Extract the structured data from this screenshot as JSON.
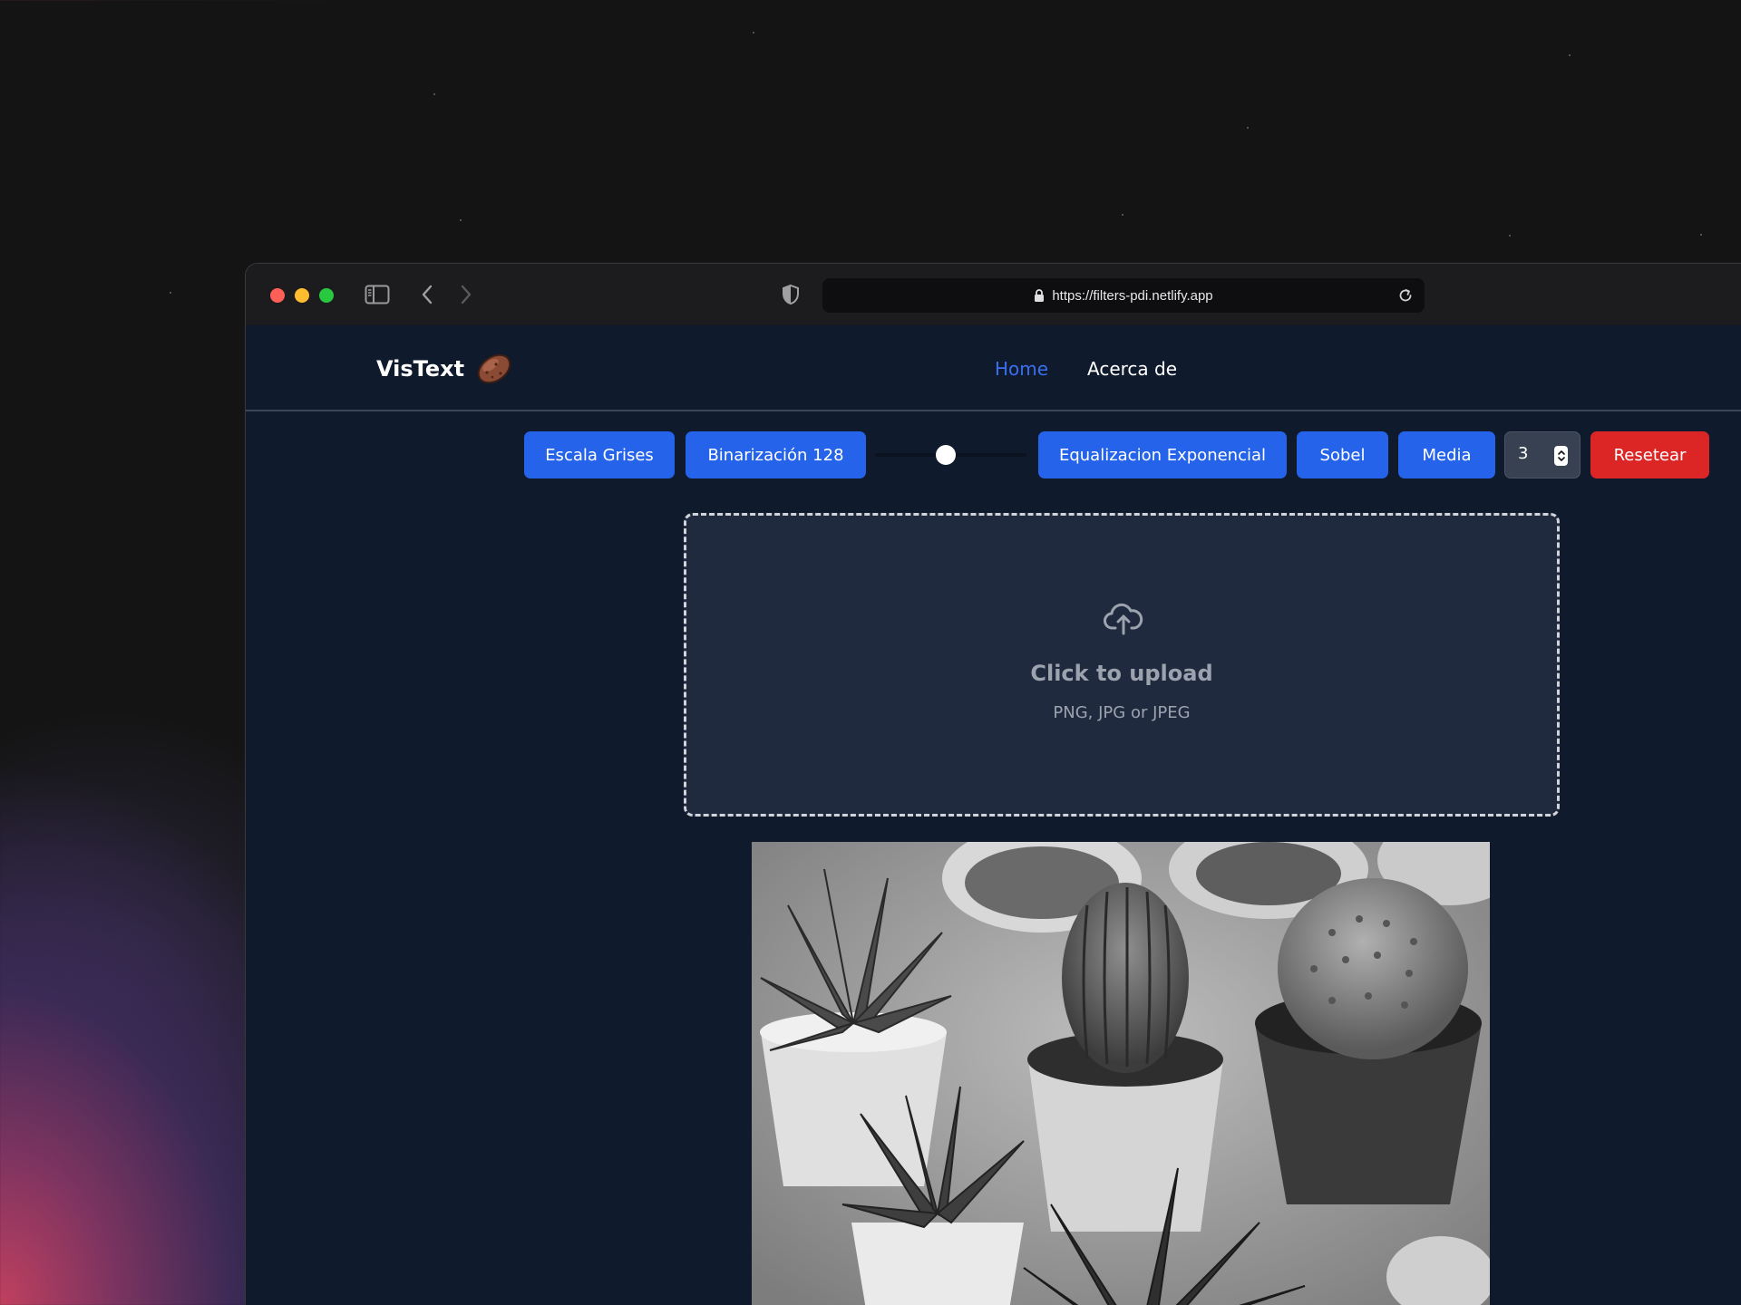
{
  "browser": {
    "url": "https://filters-pdi.netlify.app"
  },
  "header": {
    "brand": "VisText",
    "nav": {
      "home": "Home",
      "about": "Acerca de"
    }
  },
  "toolbar": {
    "grayscale_label": "Escala Grises",
    "binarize_label": "Binarización 128",
    "threshold_slider_level": 0.5,
    "equalize_label": "Equalizacion Exponencial",
    "sobel_label": "Sobel",
    "mean_label": "Media",
    "kernel_size_value": "3",
    "reset_label": "Resetear"
  },
  "upload": {
    "title": "Click to upload",
    "subtitle": "PNG, JPG or JPEG"
  },
  "colors": {
    "primary": "#2563eb",
    "danger": "#dc2626",
    "nav_active": "#3b6ff0",
    "page_bg": "#0f1a2d"
  },
  "icons": [
    "sidebar-icon",
    "chevron-left-icon",
    "chevron-right-icon",
    "shield-icon",
    "lock-icon",
    "reload-icon",
    "cloud-upload-icon",
    "stepper-arrows-icon"
  ]
}
